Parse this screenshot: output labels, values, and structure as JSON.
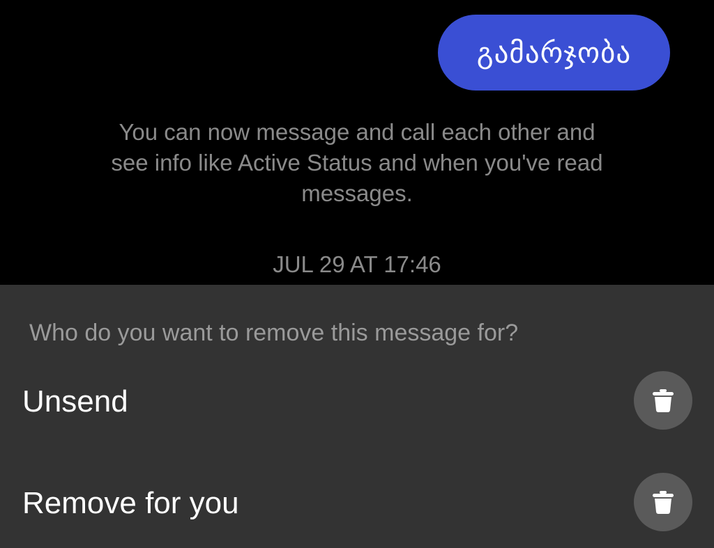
{
  "conversation": {
    "sent_message": "გამარჯობა",
    "system_note": "You can now message and call each other and see info like Active Status and when you've read messages.",
    "timestamp": "JUL 29 AT 17:46"
  },
  "remove_sheet": {
    "prompt": "Who do you want to remove this message for?",
    "actions": [
      {
        "label": "Unsend",
        "icon": "trash-icon"
      },
      {
        "label": "Remove for you",
        "icon": "trash-icon"
      }
    ]
  },
  "colors": {
    "background": "#000000",
    "bubble": "#3a4fd4",
    "sheet": "#333333",
    "icon_circle": "#5a5a5a",
    "muted_text": "#8a8a8a"
  }
}
